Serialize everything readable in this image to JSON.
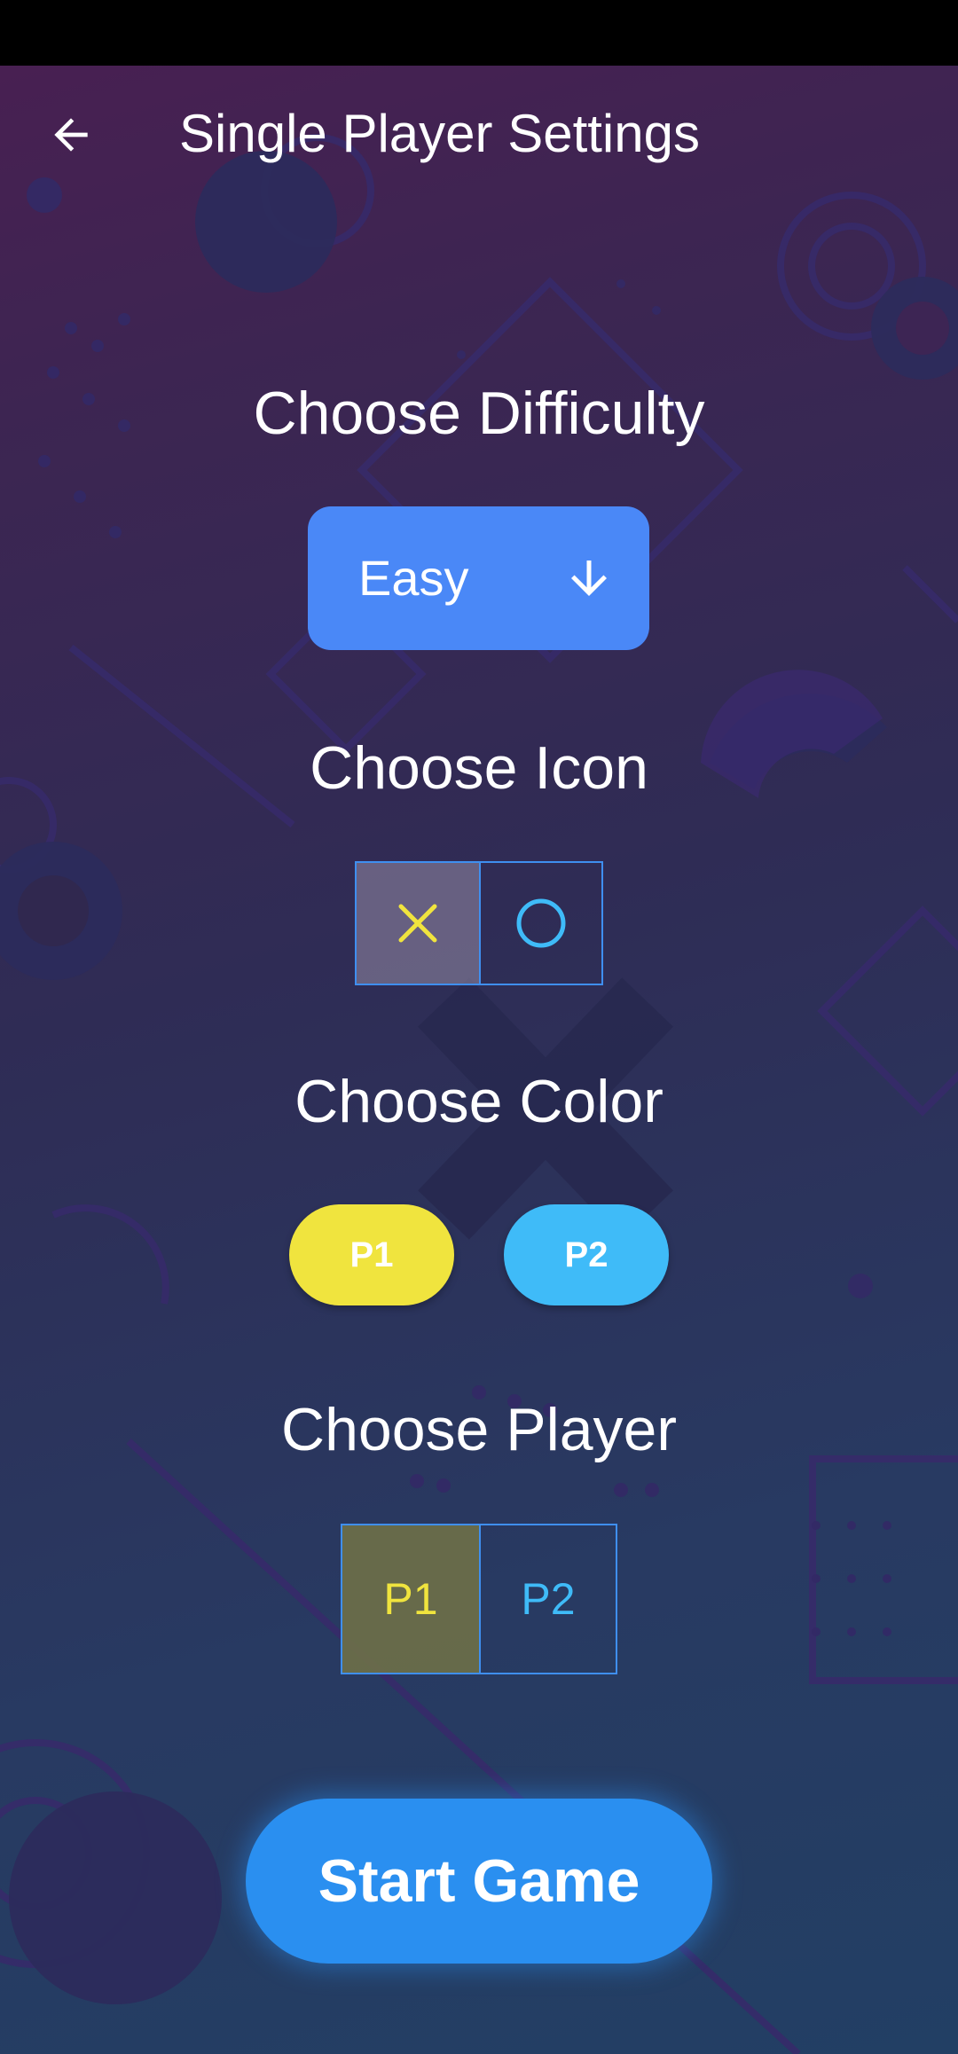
{
  "app_bar": {
    "back_icon": "arrow-left-icon",
    "title": "Single Player Settings"
  },
  "difficulty": {
    "heading": "Choose Difficulty",
    "selected": "Easy",
    "icon": "arrow-down-icon",
    "color": "#4a88f7"
  },
  "icon_choice": {
    "heading": "Choose Icon",
    "options": [
      {
        "name": "x-icon",
        "color": "#f0e43e",
        "selected": true
      },
      {
        "name": "o-icon",
        "color": "#3fbbf8",
        "selected": false
      }
    ]
  },
  "color_choice": {
    "heading": "Choose Color",
    "p1_label": "P1",
    "p1_color": "#f0e43e",
    "p2_label": "P2",
    "p2_color": "#3fbbf8"
  },
  "player_choice": {
    "heading": "Choose Player",
    "p1_label": "P1",
    "p2_label": "P2",
    "selected": "P1"
  },
  "start_button": {
    "label": "Start Game",
    "color": "#2a8ff0"
  }
}
